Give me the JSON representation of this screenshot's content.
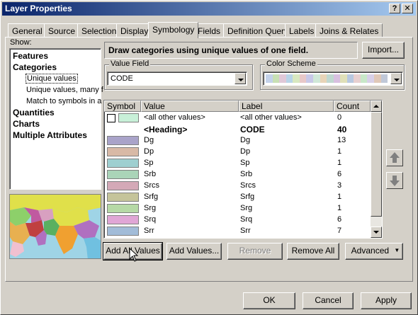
{
  "window": {
    "title": "Layer Properties"
  },
  "titlebar": {
    "help": "?",
    "close": "✕"
  },
  "tabs": [
    "General",
    "Source",
    "Selection",
    "Display",
    "Symbology",
    "Fields",
    "Definition Query",
    "Labels",
    "Joins & Relates"
  ],
  "active_tab": "Symbology",
  "show": {
    "label": "Show:",
    "items": [
      {
        "label": "Features",
        "bold": true
      },
      {
        "label": "Categories",
        "bold": true
      },
      {
        "label": "Unique values",
        "sub": true,
        "selected": true
      },
      {
        "label": "Unique values, many f",
        "sub": true
      },
      {
        "label": "Match to symbols in a",
        "sub": true
      },
      {
        "label": "Quantities",
        "bold": true
      },
      {
        "label": "Charts",
        "bold": true
      },
      {
        "label": "Multiple Attributes",
        "bold": true
      }
    ]
  },
  "description": "Draw categories using unique values of one field.",
  "import_button": "Import...",
  "value_field": {
    "label": "Value Field",
    "value": "CODE"
  },
  "color_scheme": {
    "label": "Color Scheme",
    "swatches": [
      "#c4d2ea",
      "#c8e0b4",
      "#e0c8d8",
      "#b8d4e8",
      "#d8e8c0",
      "#e8c8c8",
      "#c8c8e8",
      "#d0e8d8",
      "#e8d4b8",
      "#c0d8d0",
      "#d8c0e0",
      "#e0e0b8",
      "#b8c8e0",
      "#e8d0d0",
      "#c8e8c8",
      "#d8d0e8",
      "#e0c8b8",
      "#c0c8d8"
    ]
  },
  "grid": {
    "headers": {
      "symbol": "Symbol",
      "value": "Value",
      "label": "Label",
      "count": "Count"
    },
    "rows": [
      {
        "color": "#ffffff",
        "bordered": true,
        "value": "<all other values>",
        "label": "<all other values>",
        "count": "0"
      },
      {
        "color": null,
        "heading": true,
        "value": "<Heading>",
        "label": "CODE",
        "count": "40"
      },
      {
        "color": "#a9a3c9",
        "value": "Dg",
        "label": "Dg",
        "count": "13"
      },
      {
        "color": "#d8b9a6",
        "value": "Dp",
        "label": "Dp",
        "count": "1"
      },
      {
        "color": "#9ecfd0",
        "value": "Sp",
        "label": "Sp",
        "count": "1"
      },
      {
        "color": "#aad4b8",
        "value": "Srb",
        "label": "Srb",
        "count": "6"
      },
      {
        "color": "#d4a9b7",
        "value": "Srcs",
        "label": "Srcs",
        "count": "3"
      },
      {
        "color": "#c5c49a",
        "value": "Srfg",
        "label": "Srfg",
        "count": "1"
      },
      {
        "color": "#b6d9a6",
        "value": "Srg",
        "label": "Srg",
        "count": "1"
      },
      {
        "color": "#e0a6d6",
        "value": "Srq",
        "label": "Srq",
        "count": "6"
      },
      {
        "color": "#a2bcd8",
        "value": "Srr",
        "label": "Srr",
        "count": "7"
      }
    ],
    "first_row_swatch": "#c8f0d8"
  },
  "buttons": {
    "add_all": "Add All Values",
    "add": "Add Values...",
    "remove": "Remove",
    "remove_all": "Remove All",
    "advanced": "Advanced"
  },
  "footer": {
    "ok": "OK",
    "cancel": "Cancel",
    "apply": "Apply"
  },
  "colors": {
    "title_start": "#0a246a",
    "title_end": "#a6caf0",
    "face": "#d4d0c8"
  }
}
